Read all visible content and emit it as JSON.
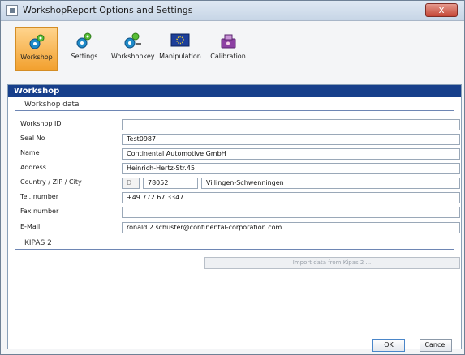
{
  "window": {
    "title": "WorkshopReport Options and Settings",
    "close_label": "x"
  },
  "toolbar": {
    "items": [
      {
        "label": "Workshop",
        "icon": "gears-icon",
        "active": true
      },
      {
        "label": "Settings",
        "icon": "gears-icon",
        "active": false
      },
      {
        "label": "Workshopkey",
        "icon": "gears-key-icon",
        "active": false
      },
      {
        "label": "Manipulation",
        "icon": "eu-flag-icon",
        "active": false
      },
      {
        "label": "Calibration",
        "icon": "tool-box-icon",
        "active": false
      }
    ]
  },
  "section": {
    "title": "Workshop",
    "workshop_data_label": "Workshop data",
    "kipas_label": "KIPAS 2"
  },
  "form": {
    "workshop_id": {
      "label": "Workshop ID",
      "value": ""
    },
    "seal_no": {
      "label": "Seal No",
      "value": "Test0987"
    },
    "name": {
      "label": "Name",
      "value": "Continental Automotive GmbH"
    },
    "address": {
      "label": "Address",
      "value": "Heinrich-Hertz-Str.45"
    },
    "country_zip_city": {
      "label": "Country / ZIP / City",
      "country": "D",
      "zip": "78052",
      "city": "Villingen-Schwenningen"
    },
    "tel_number": {
      "label": "Tel. number",
      "value": "+49 772 67 3347"
    },
    "fax_number": {
      "label": "Fax number",
      "value": ""
    },
    "email": {
      "label": "E-Mail",
      "value": "ronald.2.schuster@continental-corporation.com"
    }
  },
  "buttons": {
    "import_label": "Import data from Kipas 2 ...",
    "ok_label": "OK",
    "cancel_label": "Cancel"
  },
  "colors": {
    "section_header": "#173f8b",
    "active_tab": "#f2a12f",
    "accent": "#6e86b4"
  }
}
